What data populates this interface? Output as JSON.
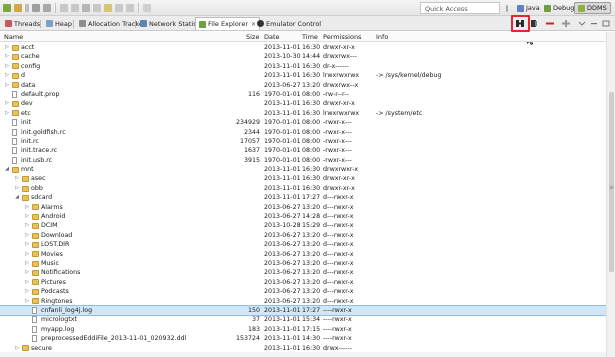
{
  "toolbar": {
    "quick_access_placeholder": "Quick Access",
    "perspectives": {
      "java": "Java",
      "debug": "Debug",
      "ddms": "DDMS"
    }
  },
  "tabs": [
    {
      "label": "Threads",
      "icon": "threads-icon",
      "active": false
    },
    {
      "label": "Heap",
      "icon": "heap-icon",
      "active": false
    },
    {
      "label": "Allocation Tracker",
      "icon": "allocation-icon",
      "active": false
    },
    {
      "label": "Network Statistics",
      "icon": "network-icon",
      "active": false
    },
    {
      "label": "File Explorer",
      "icon": "file-explorer-icon",
      "active": true,
      "close": "✕"
    },
    {
      "label": "Emulator Control",
      "icon": "emulator-icon",
      "active": false
    }
  ],
  "columns": {
    "name": "Name",
    "size": "Size",
    "date": "Date",
    "time": "Time",
    "permissions": "Permissions",
    "info": "Info"
  },
  "rows": [
    {
      "name": "acct",
      "level": 0,
      "type": "folder",
      "expanded": false,
      "size": "",
      "date": "2013-11-01",
      "time": "16:30",
      "perm": "drwxr-xr-x",
      "info": ""
    },
    {
      "name": "cache",
      "level": 0,
      "type": "folder",
      "expanded": false,
      "size": "",
      "date": "2013-10-30",
      "time": "14:44",
      "perm": "drwxrwx---",
      "info": ""
    },
    {
      "name": "config",
      "level": 0,
      "type": "folder",
      "expanded": false,
      "size": "",
      "date": "2013-11-01",
      "time": "16:30",
      "perm": "dr-x------",
      "info": ""
    },
    {
      "name": "d",
      "level": 0,
      "type": "folder",
      "expanded": false,
      "size": "",
      "date": "2013-11-01",
      "time": "16:30",
      "perm": "lrwxrwxrwx",
      "info": "-> /sys/kernel/debug"
    },
    {
      "name": "data",
      "level": 0,
      "type": "folder",
      "expanded": false,
      "size": "",
      "date": "2013-06-27",
      "time": "13:20",
      "perm": "drwxrwx--x",
      "info": ""
    },
    {
      "name": "default.prop",
      "level": 0,
      "type": "file",
      "size": "116",
      "date": "1970-01-01",
      "time": "08:00",
      "perm": "-rw-r--r--",
      "info": ""
    },
    {
      "name": "dev",
      "level": 0,
      "type": "folder",
      "expanded": false,
      "size": "",
      "date": "2013-11-01",
      "time": "16:30",
      "perm": "drwxr-xr-x",
      "info": ""
    },
    {
      "name": "etc",
      "level": 0,
      "type": "folder",
      "expanded": false,
      "size": "",
      "date": "2013-11-01",
      "time": "16:30",
      "perm": "lrwxrwxrwx",
      "info": "-> /system/etc"
    },
    {
      "name": "init",
      "level": 0,
      "type": "file",
      "size": "234929",
      "date": "1970-01-01",
      "time": "08:00",
      "perm": "-rwxr-x---",
      "info": ""
    },
    {
      "name": "init.goldfish.rc",
      "level": 0,
      "type": "file",
      "size": "2344",
      "date": "1970-01-01",
      "time": "08:00",
      "perm": "-rwxr-x---",
      "info": ""
    },
    {
      "name": "init.rc",
      "level": 0,
      "type": "file",
      "size": "17057",
      "date": "1970-01-01",
      "time": "08:00",
      "perm": "-rwxr-x---",
      "info": ""
    },
    {
      "name": "init.trace.rc",
      "level": 0,
      "type": "file",
      "size": "1637",
      "date": "1970-01-01",
      "time": "08:00",
      "perm": "-rwxr-x---",
      "info": ""
    },
    {
      "name": "init.usb.rc",
      "level": 0,
      "type": "file",
      "size": "3915",
      "date": "1970-01-01",
      "time": "08:00",
      "perm": "-rwxr-x---",
      "info": ""
    },
    {
      "name": "mnt",
      "level": 0,
      "type": "folder",
      "expanded": true,
      "size": "",
      "date": "2013-11-01",
      "time": "16:30",
      "perm": "drwxrwxr-x",
      "info": ""
    },
    {
      "name": "asec",
      "level": 1,
      "type": "folder",
      "expanded": false,
      "size": "",
      "date": "2013-11-01",
      "time": "16:30",
      "perm": "drwxr-xr-x",
      "info": ""
    },
    {
      "name": "obb",
      "level": 1,
      "type": "folder",
      "expanded": false,
      "size": "",
      "date": "2013-11-01",
      "time": "16:30",
      "perm": "drwxr-xr-x",
      "info": ""
    },
    {
      "name": "sdcard",
      "level": 1,
      "type": "folder",
      "expanded": true,
      "size": "",
      "date": "2013-11-01",
      "time": "17:27",
      "perm": "d---rwxr-x",
      "info": ""
    },
    {
      "name": "Alarms",
      "level": 2,
      "type": "folder",
      "expanded": false,
      "size": "",
      "date": "2013-06-27",
      "time": "13:20",
      "perm": "d---rwxr-x",
      "info": ""
    },
    {
      "name": "Android",
      "level": 2,
      "type": "folder",
      "expanded": false,
      "size": "",
      "date": "2013-06-27",
      "time": "14:28",
      "perm": "d---rwxr-x",
      "info": ""
    },
    {
      "name": "DCIM",
      "level": 2,
      "type": "folder",
      "expanded": false,
      "size": "",
      "date": "2013-10-28",
      "time": "15:29",
      "perm": "d---rwxr-x",
      "info": ""
    },
    {
      "name": "Download",
      "level": 2,
      "type": "folder",
      "expanded": false,
      "size": "",
      "date": "2013-06-27",
      "time": "13:20",
      "perm": "d---rwxr-x",
      "info": ""
    },
    {
      "name": "LOST.DIR",
      "level": 2,
      "type": "folder",
      "expanded": false,
      "size": "",
      "date": "2013-06-27",
      "time": "13:20",
      "perm": "d---rwxr-x",
      "info": ""
    },
    {
      "name": "Movies",
      "level": 2,
      "type": "folder",
      "expanded": false,
      "size": "",
      "date": "2013-06-27",
      "time": "13:20",
      "perm": "d---rwxr-x",
      "info": ""
    },
    {
      "name": "Music",
      "level": 2,
      "type": "folder",
      "expanded": false,
      "size": "",
      "date": "2013-06-27",
      "time": "13:20",
      "perm": "d---rwxr-x",
      "info": ""
    },
    {
      "name": "Notifications",
      "level": 2,
      "type": "folder",
      "expanded": false,
      "size": "",
      "date": "2013-06-27",
      "time": "13:20",
      "perm": "d---rwxr-x",
      "info": ""
    },
    {
      "name": "Pictures",
      "level": 2,
      "type": "folder",
      "expanded": false,
      "size": "",
      "date": "2013-06-27",
      "time": "13:20",
      "perm": "d---rwxr-x",
      "info": ""
    },
    {
      "name": "Podcasts",
      "level": 2,
      "type": "folder",
      "expanded": false,
      "size": "",
      "date": "2013-06-27",
      "time": "13:20",
      "perm": "d---rwxr-x",
      "info": ""
    },
    {
      "name": "Ringtones",
      "level": 2,
      "type": "folder",
      "expanded": false,
      "size": "",
      "date": "2013-06-27",
      "time": "13:20",
      "perm": "d---rwxr-x",
      "info": ""
    },
    {
      "name": "cnfanli_log4j.log",
      "level": 2,
      "type": "file",
      "selected": true,
      "size": "150",
      "date": "2013-11-01",
      "time": "17:27",
      "perm": "----rwxr-x",
      "info": ""
    },
    {
      "name": "micrologtxt",
      "level": 2,
      "type": "file",
      "size": "37",
      "date": "2013-11-01",
      "time": "15:34",
      "perm": "----rwxr-x",
      "info": ""
    },
    {
      "name": "myapp.log",
      "level": 2,
      "type": "file",
      "size": "183",
      "date": "2013-11-01",
      "time": "17:15",
      "perm": "----rwxr-x",
      "info": ""
    },
    {
      "name": "preprocessedEddiFile_2013-11-01_020932.ddl",
      "level": 2,
      "type": "file",
      "size": "153724",
      "date": "2013-11-01",
      "time": "14:30",
      "perm": "----rwxr-x",
      "info": ""
    },
    {
      "name": "secure",
      "level": 1,
      "type": "folder",
      "expanded": false,
      "size": "",
      "date": "2013-11-01",
      "time": "16:30",
      "perm": "drwx------",
      "info": ""
    }
  ],
  "colors": {
    "selection": "#cfe6fb",
    "highlight_box": "#e3262f",
    "folder": "#e8c25a"
  }
}
